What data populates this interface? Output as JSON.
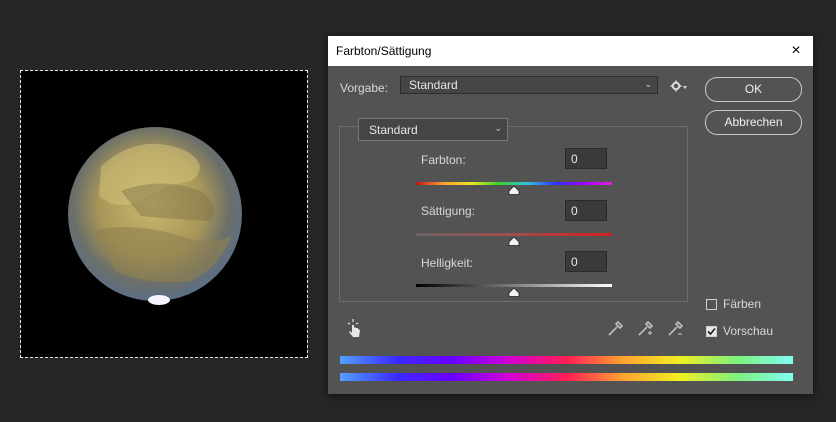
{
  "dialog": {
    "title": "Farbton/Sättigung",
    "close_icon": "×",
    "preset_label": "Vorgabe:",
    "preset_value": "Standard",
    "ok_label": "OK",
    "cancel_label": "Abbrechen",
    "channel_value": "Standard",
    "sliders": [
      {
        "label": "Farbton:",
        "value": "0",
        "level_percent": 50
      },
      {
        "label": "Sättigung:",
        "value": "0",
        "level_percent": 50
      },
      {
        "label": "Helligkeit:",
        "value": "0",
        "level_percent": 50
      }
    ],
    "colorize_label": "Färben",
    "colorize_checked": false,
    "preview_label": "Vorschau",
    "preview_checked": true
  },
  "icons": [
    "close-icon",
    "chevron-down-icon",
    "gear-icon",
    "hand-target-icon",
    "eyedropper-icon",
    "eyedropper-plus-icon",
    "eyedropper-minus-icon",
    "checkmark-icon"
  ],
  "colors": {
    "dialog_bg": "#535353",
    "canvas_bg": "#262626",
    "hue_spectrum": [
      "#54a0ff",
      "#3a2bff",
      "#6a00ff",
      "#d400d4",
      "#ff1f55",
      "#ffa230",
      "#f0f020",
      "#7df07d",
      "#7fffef"
    ]
  }
}
